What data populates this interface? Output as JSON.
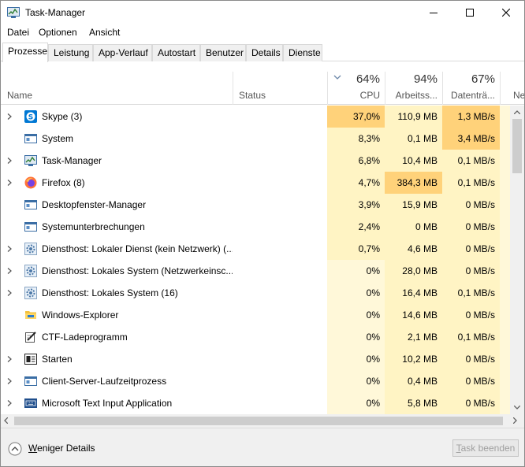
{
  "window": {
    "title": "Task-Manager"
  },
  "menu": [
    {
      "label": "Datei"
    },
    {
      "label": "Optionen"
    },
    {
      "label": "Ansicht"
    }
  ],
  "tabs": [
    {
      "label": "Prozesse",
      "active": true
    },
    {
      "label": "Leistung"
    },
    {
      "label": "App-Verlauf"
    },
    {
      "label": "Autostart"
    },
    {
      "label": "Benutzer"
    },
    {
      "label": "Details"
    },
    {
      "label": "Dienste"
    }
  ],
  "columns": {
    "name": "Name",
    "status": "Status",
    "cpu": {
      "percent": "64%",
      "label": "CPU"
    },
    "memory": {
      "percent": "94%",
      "label": "Arbeitss..."
    },
    "disk": {
      "percent": "67%",
      "label": "Datenträ..."
    },
    "network": {
      "label": "Ne"
    }
  },
  "processes": [
    {
      "name": "Skype (3)",
      "icon": "skype-icon",
      "expandable": true,
      "cpu": "37,0%",
      "memory": "110,9 MB",
      "disk": "1,3 MB/s",
      "cpu_level": "high",
      "mem_level": "low",
      "disk_level": "high"
    },
    {
      "name": "System",
      "icon": "system-icon",
      "expandable": false,
      "cpu": "8,3%",
      "memory": "0,1 MB",
      "disk": "3,4 MB/s",
      "cpu_level": "low",
      "mem_level": "low",
      "disk_level": "high"
    },
    {
      "name": "Task-Manager",
      "icon": "task-manager-icon",
      "expandable": true,
      "cpu": "6,8%",
      "memory": "10,4 MB",
      "disk": "0,1 MB/s",
      "cpu_level": "low",
      "mem_level": "low",
      "disk_level": "low"
    },
    {
      "name": "Firefox (8)",
      "icon": "firefox-icon",
      "expandable": true,
      "cpu": "4,7%",
      "memory": "384,3 MB",
      "disk": "0,1 MB/s",
      "cpu_level": "low",
      "mem_level": "high",
      "disk_level": "low"
    },
    {
      "name": "Desktopfenster-Manager",
      "icon": "system-icon",
      "expandable": false,
      "cpu": "3,9%",
      "memory": "15,9 MB",
      "disk": "0 MB/s",
      "cpu_level": "low",
      "mem_level": "low",
      "disk_level": "low"
    },
    {
      "name": "Systemunterbrechungen",
      "icon": "system-icon",
      "expandable": false,
      "cpu": "2,4%",
      "memory": "0 MB",
      "disk": "0 MB/s",
      "cpu_level": "low",
      "mem_level": "low",
      "disk_level": "low"
    },
    {
      "name": "Diensthost: Lokaler Dienst (kein Netzwerk) (...",
      "icon": "gear-icon",
      "expandable": true,
      "cpu": "0,7%",
      "memory": "4,6 MB",
      "disk": "0 MB/s",
      "cpu_level": "low",
      "mem_level": "low",
      "disk_level": "low"
    },
    {
      "name": "Diensthost: Lokales System (Netzwerkeinsc...",
      "icon": "gear-icon",
      "expandable": true,
      "cpu": "0%",
      "memory": "28,0 MB",
      "disk": "0 MB/s",
      "cpu_level": "none",
      "mem_level": "low",
      "disk_level": "low"
    },
    {
      "name": "Diensthost: Lokales System (16)",
      "icon": "gear-icon",
      "expandable": true,
      "cpu": "0%",
      "memory": "16,4 MB",
      "disk": "0,1 MB/s",
      "cpu_level": "none",
      "mem_level": "low",
      "disk_level": "low"
    },
    {
      "name": "Windows-Explorer",
      "icon": "folder-icon",
      "expandable": false,
      "cpu": "0%",
      "memory": "14,6 MB",
      "disk": "0 MB/s",
      "cpu_level": "none",
      "mem_level": "low",
      "disk_level": "low"
    },
    {
      "name": "CTF-Ladeprogramm",
      "icon": "pen-icon",
      "expandable": false,
      "cpu": "0%",
      "memory": "2,1 MB",
      "disk": "0,1 MB/s",
      "cpu_level": "none",
      "mem_level": "low",
      "disk_level": "low"
    },
    {
      "name": "Starten",
      "icon": "start-icon",
      "expandable": true,
      "cpu": "0%",
      "memory": "10,2 MB",
      "disk": "0 MB/s",
      "cpu_level": "none",
      "mem_level": "low",
      "disk_level": "low"
    },
    {
      "name": "Client-Server-Laufzeitprozess",
      "icon": "system-icon",
      "expandable": true,
      "cpu": "0%",
      "memory": "0,4 MB",
      "disk": "0 MB/s",
      "cpu_level": "none",
      "mem_level": "low",
      "disk_level": "low"
    },
    {
      "name": "Microsoft Text Input Application",
      "icon": "keyboard-icon",
      "expandable": true,
      "cpu": "0%",
      "memory": "5,8 MB",
      "disk": "0 MB/s",
      "cpu_level": "none",
      "mem_level": "low",
      "disk_level": "low"
    }
  ],
  "footer": {
    "fewer_details": "Weniger Details",
    "end_task": "Task beenden"
  },
  "colors": {
    "heat_high": "#ffd27a",
    "heat_mid": "#fff0b4",
    "heat_low": "#fff4c4",
    "heat_none": "#fff8d9"
  }
}
